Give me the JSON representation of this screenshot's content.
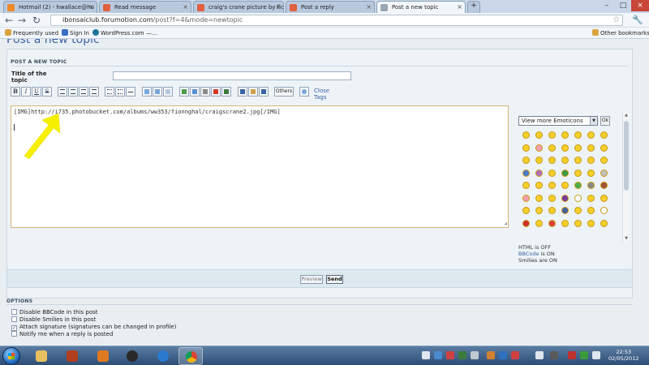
{
  "browser": {
    "tabs": [
      {
        "label": "Hotmail (2) - hwallace@ho",
        "icon_color": "#f08a2a",
        "active": false
      },
      {
        "label": "Read message",
        "icon_color": "#e06040",
        "active": false
      },
      {
        "label": "craig's crane picture by fion",
        "icon_color": "#e06040",
        "active": false
      },
      {
        "label": "Post a reply",
        "icon_color": "#e06040",
        "active": false
      },
      {
        "label": "Post a new topic",
        "icon_color": "#9aa6b4",
        "active": true
      }
    ],
    "url_host": "ibonsaiclub.forumotion.com",
    "url_path": "/post?f=4&mode=newtopic",
    "bookmarks": [
      "Frequently used",
      "Sign In",
      "WordPress.com —..."
    ],
    "other_bookmarks": "Other bookmarks"
  },
  "page": {
    "title": "Post a new topic",
    "section_header": "POST A NEW TOPIC",
    "title_label": "Title of the topic",
    "title_value": "",
    "toolbar": {
      "bold": "B",
      "italic": "I",
      "underline": "U",
      "strike": "S",
      "others": "Others",
      "close_tags": "Close Tags"
    },
    "message_text": "[IMG]http://i735.photobucket.com/albums/ww353/fionnghal/craigscrane2.jpg[/IMG]",
    "emoticons": {
      "select_label": "View more Emoticons",
      "ok_label": "Ok"
    },
    "status": {
      "html": "HTML is OFF",
      "bbcode_link": "BBCode",
      "bbcode_rest": " is ON",
      "smilies": "Smilies are ON"
    },
    "buttons": {
      "preview": "Preview",
      "send": "Send"
    },
    "options": {
      "header": "OPTIONS",
      "items": [
        {
          "label": "Disable BBCode in this post",
          "checked": false
        },
        {
          "label": "Disable Smilies in this post",
          "checked": false
        },
        {
          "label": "Attach signature (signatures can be changed in profile)",
          "checked": true
        },
        {
          "label": "Notify me when a reply is posted",
          "checked": false
        }
      ]
    }
  },
  "taskbar": {
    "time": "22:53",
    "date": "02/05/2012"
  },
  "colors": {
    "link": "#3b63a6",
    "annotation_arrow": "#f6f000"
  }
}
